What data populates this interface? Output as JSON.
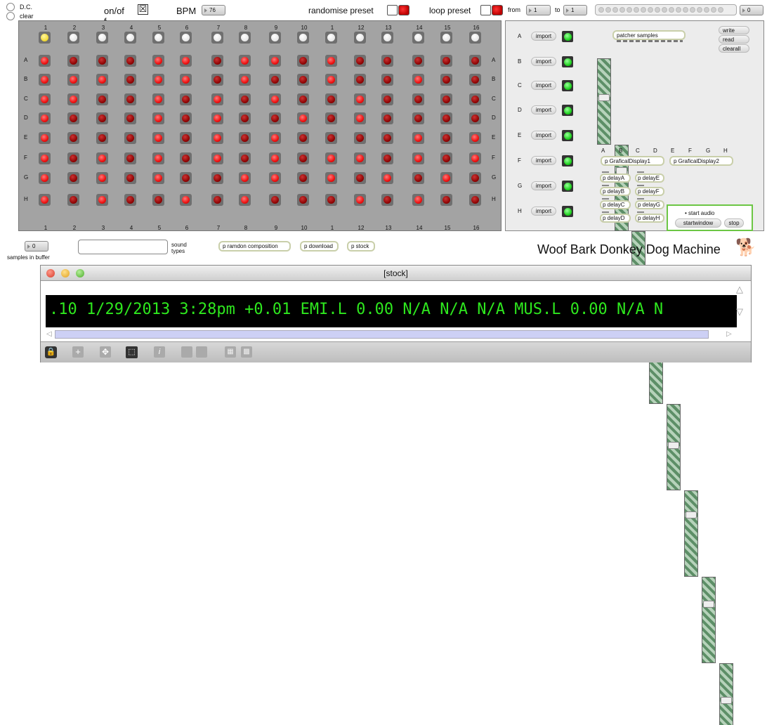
{
  "top": {
    "dc": "D.C.",
    "clear": "clear",
    "onoff": "on/of\nf",
    "bpm_label": "BPM",
    "bpm_value": "76",
    "randomise": "randomise preset",
    "loop": "loop preset",
    "from": "from",
    "from_value": "1",
    "to": "to",
    "to_value": "1",
    "count_value": "0"
  },
  "grid": {
    "col_labels": [
      "1",
      "2",
      "3",
      "4",
      "5",
      "6",
      "7",
      "8",
      "9",
      "10",
      "1",
      "12",
      "13",
      "14",
      "15",
      "16"
    ],
    "row_labels": [
      "A",
      "B",
      "C",
      "D",
      "E",
      "F",
      "G",
      "H"
    ],
    "tracker_active": [
      0
    ],
    "active": [
      [
        0,
        4,
        5,
        7,
        8,
        10
      ],
      [
        0,
        1,
        2,
        4,
        5,
        7,
        10,
        13
      ],
      [
        0,
        1,
        4,
        6,
        8,
        11
      ],
      [
        0,
        4,
        6,
        9,
        11
      ],
      [
        0,
        4,
        6,
        8,
        13,
        15
      ],
      [
        0,
        2,
        4,
        6,
        8,
        10,
        11,
        13,
        15
      ],
      [
        0,
        2,
        4,
        7,
        8,
        10,
        12,
        14
      ],
      [
        0,
        2,
        5,
        7,
        11,
        13
      ]
    ]
  },
  "bottom": {
    "samples_value": "0",
    "samples_label": "samples in buffer",
    "sound_label": "sound\ntypes",
    "btn_random": "p ramdon composition",
    "btn_download": "p download",
    "btn_stock": "p stock",
    "title": "Woof Bark Donkey Dog Machine"
  },
  "right": {
    "import_rows": [
      "A",
      "B",
      "C",
      "D",
      "E",
      "F",
      "G",
      "H"
    ],
    "import_label": "import",
    "patcher": "patcher samples",
    "write": "write",
    "read": "read",
    "clearall": "clearall",
    "slider_labels": [
      "A",
      "B",
      "C",
      "D",
      "E",
      "F",
      "G",
      "H"
    ],
    "slider_levels": [
      0.55,
      0.72,
      0.58,
      0.6,
      0.52,
      0.74,
      0.7,
      0.58
    ],
    "display1": "p GraficalDisplay1",
    "display2": "p GraficalDisplay2",
    "delays_left": [
      "p delayA",
      "p delayB",
      "p delayC",
      "p delayD"
    ],
    "delays_right": [
      "p delayE",
      "p delayF",
      "p delayG",
      "p delayH"
    ],
    "start_audio": "• start audio",
    "startwindow": "startwindow",
    "stop": "stop"
  },
  "stock_window": {
    "title": "[stock]",
    "ticker": ".10 1/29/2013 3:28pm +0.01 EMI.L 0.00 N/A N/A N/A MUS.L 0.00 N/A N"
  }
}
